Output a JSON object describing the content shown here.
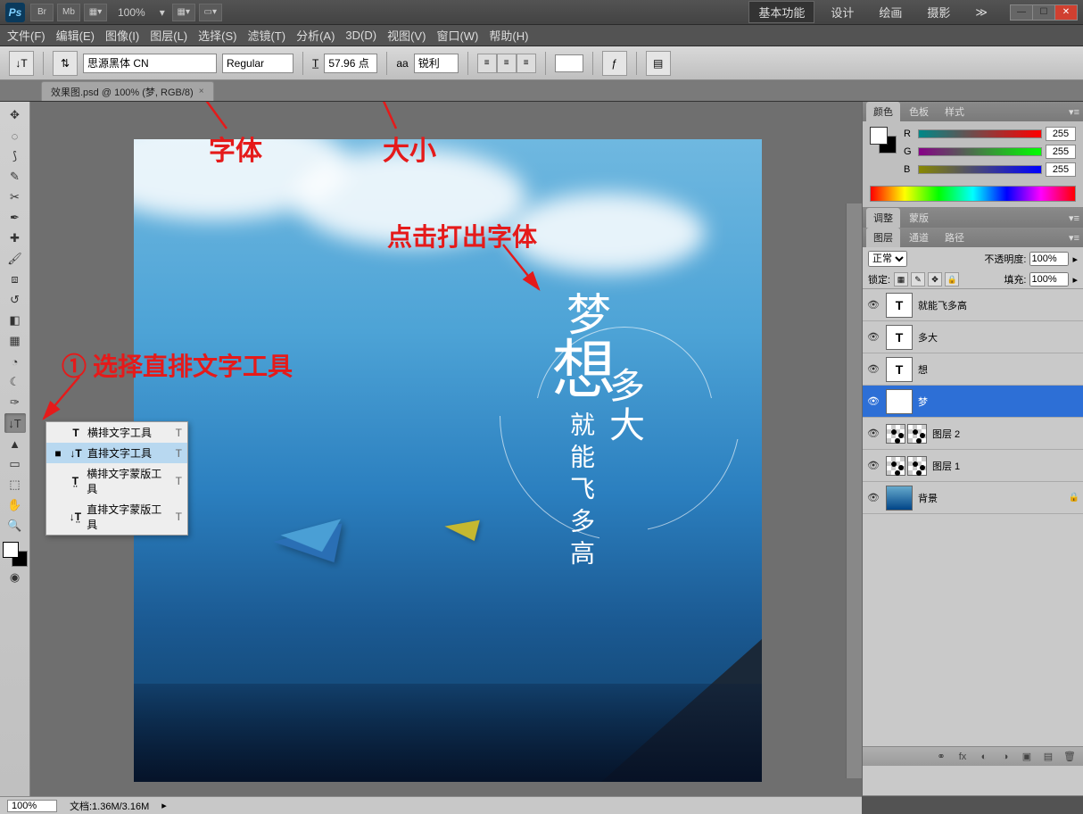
{
  "app": {
    "logo": "Ps",
    "zoom": "100%"
  },
  "workspace_tabs": {
    "essentials": "基本功能",
    "design": "设计",
    "painting": "绘画",
    "photography": "摄影"
  },
  "menu": {
    "file": "文件(F)",
    "edit": "编辑(E)",
    "image": "图像(I)",
    "layer": "图层(L)",
    "select": "选择(S)",
    "filter": "滤镜(T)",
    "analysis": "分析(A)",
    "threed": "3D(D)",
    "view": "视图(V)",
    "window": "窗口(W)",
    "help": "帮助(H)"
  },
  "options": {
    "font_family": "思源黑体 CN",
    "font_style": "Regular",
    "size_label_prefix": "",
    "font_size": "57.96 点",
    "aa_prefix": "aa",
    "aa_mode": "锐利"
  },
  "doc_tab": {
    "title": "效果图.psd @ 100% (梦, RGB/8)",
    "close": "×"
  },
  "text_tool_flyout": {
    "horizontal": "横排文字工具",
    "vertical": "直排文字工具",
    "horizontal_mask": "横排文字蒙版工具",
    "vertical_mask": "直排文字蒙版工具",
    "shortcut": "T"
  },
  "annotations": {
    "font": "字体",
    "size": "大小",
    "click_type": "点击打出字体",
    "select_vertical": "① 选择直排文字工具"
  },
  "canvas_text": {
    "meng": "梦",
    "xiang": "想",
    "duoda": "多大",
    "jiuneng": "就能飞多高"
  },
  "panels": {
    "color_tab": "颜色",
    "swatches_tab": "色板",
    "styles_tab": "样式",
    "adjust_tab": "调整",
    "mask_tab": "蒙版",
    "layers_tab": "图层",
    "channels_tab": "通道",
    "paths_tab": "路径",
    "rgb": {
      "r": "R",
      "g": "G",
      "b": "B",
      "r_val": "255",
      "g_val": "255",
      "b_val": "255"
    },
    "layer_mode": "正常",
    "opacity_label": "不透明度:",
    "opacity_val": "100%",
    "lock_label": "锁定:",
    "fill_label": "填充:",
    "fill_val": "100%",
    "layers": {
      "l1": "就能飞多高",
      "l2": "多大",
      "l3": "想",
      "l4": "梦",
      "l5": "图层 2",
      "l6": "图层 1",
      "l7": "背景"
    }
  },
  "status": {
    "zoom": "100%",
    "docinfo": "文档:1.36M/3.16M"
  }
}
